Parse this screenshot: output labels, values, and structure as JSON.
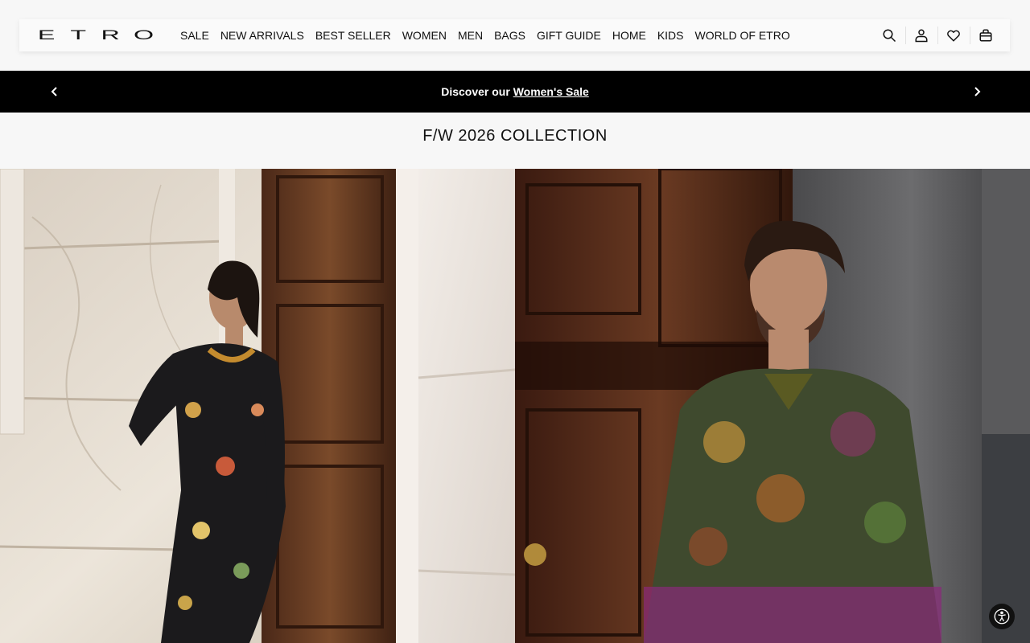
{
  "brand": {
    "logo_letters": [
      "E",
      "T",
      "R",
      "O"
    ]
  },
  "nav": {
    "items": [
      {
        "label": "SALE"
      },
      {
        "label": "NEW ARRIVALS"
      },
      {
        "label": "BEST SELLER"
      },
      {
        "label": "WOMEN"
      },
      {
        "label": "MEN"
      },
      {
        "label": "BAGS"
      },
      {
        "label": "GIFT GUIDE"
      },
      {
        "label": "HOME"
      },
      {
        "label": "KIDS"
      },
      {
        "label": "WORLD OF ETRO"
      }
    ]
  },
  "header_icons": [
    "search-icon",
    "account-icon",
    "wishlist-icon",
    "cart-icon"
  ],
  "promo": {
    "prefix": "Discover our ",
    "link": "Women's Sale"
  },
  "collection": {
    "title": "F/W 2026 COLLECTION"
  },
  "colors": {
    "promo_bg": "#000000",
    "page_bg": "#f7f7f7"
  }
}
